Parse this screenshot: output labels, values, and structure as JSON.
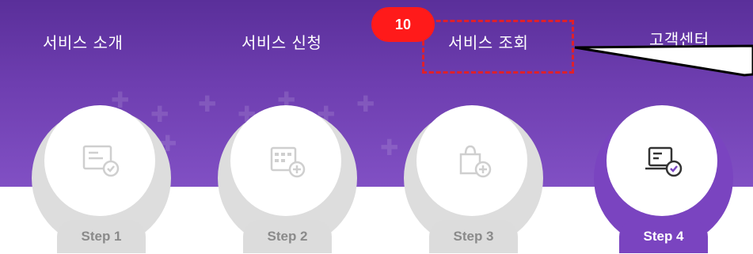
{
  "nav": {
    "items": [
      {
        "label": "서비스 소개"
      },
      {
        "label": "서비스 신청"
      },
      {
        "label": "서비스 조회"
      },
      {
        "label": "고객센터"
      }
    ]
  },
  "annotation": {
    "badge": "10",
    "highlight_color": "#e0202a",
    "badge_color": "#ff1a1a"
  },
  "steps": [
    {
      "label": "Step 1",
      "icon": "card-check-icon",
      "active": false
    },
    {
      "label": "Step 2",
      "icon": "calculator-plus-icon",
      "active": false
    },
    {
      "label": "Step 3",
      "icon": "shopping-bag-plus-icon",
      "active": false
    },
    {
      "label": "Step 4",
      "icon": "laptop-check-icon",
      "active": true
    }
  ],
  "colors": {
    "hero": "#6e3eb0",
    "active": "#7a44c0",
    "inactive": "#dddddd"
  }
}
